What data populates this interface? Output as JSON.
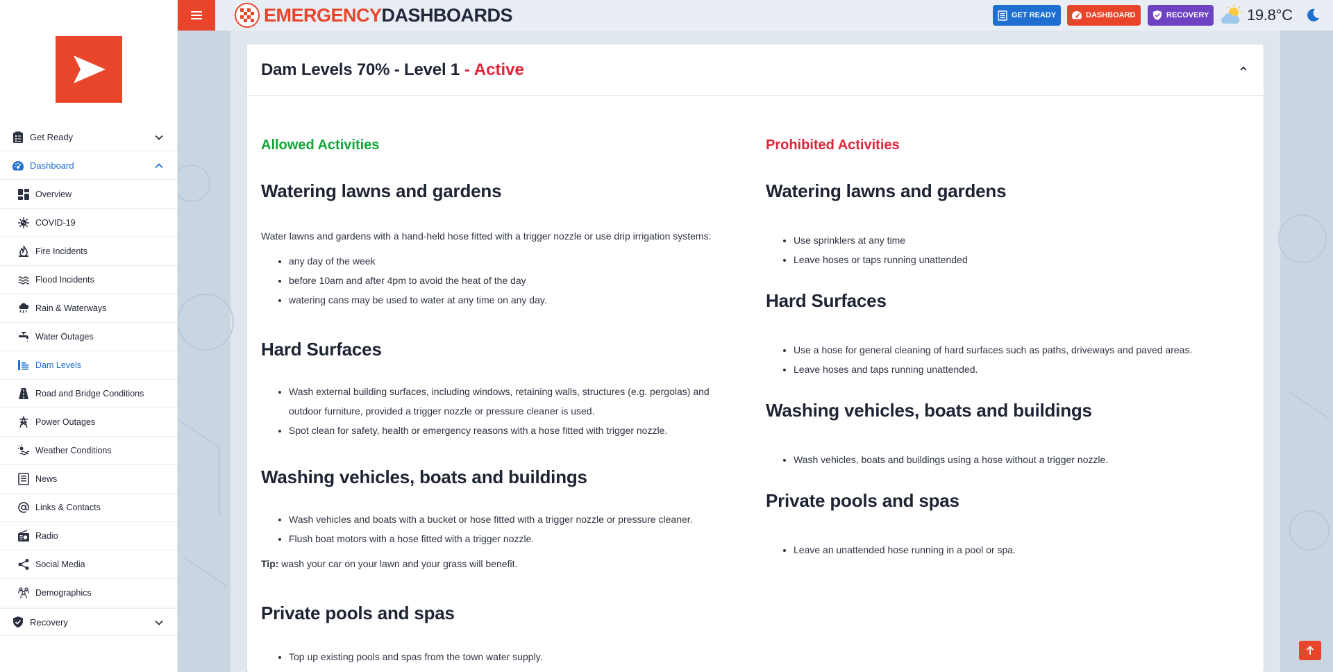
{
  "sidebar": {
    "groups": {
      "get_ready": "Get Ready",
      "dashboard": "Dashboard",
      "recovery": "Recovery"
    },
    "items": [
      {
        "label": "Overview",
        "icon": "grid-icon"
      },
      {
        "label": "COVID-19",
        "icon": "virus-icon"
      },
      {
        "label": "Fire Incidents",
        "icon": "fire-icon"
      },
      {
        "label": "Flood Incidents",
        "icon": "waves-icon"
      },
      {
        "label": "Rain & Waterways",
        "icon": "rain-cloud-icon"
      },
      {
        "label": "Water Outages",
        "icon": "tap-icon"
      },
      {
        "label": "Dam Levels",
        "icon": "dam-levels-icon",
        "active": true
      },
      {
        "label": "Road and Bridge Conditions",
        "icon": "road-icon"
      },
      {
        "label": "Power Outages",
        "icon": "power-pylon-icon"
      },
      {
        "label": "Weather Conditions",
        "icon": "weather-icon"
      },
      {
        "label": "News",
        "icon": "newspaper-icon"
      },
      {
        "label": "Links & Contacts",
        "icon": "at-sign-icon"
      },
      {
        "label": "Radio",
        "icon": "radio-icon"
      },
      {
        "label": "Social Media",
        "icon": "share-icon"
      },
      {
        "label": "Demographics",
        "icon": "people-icon"
      }
    ]
  },
  "topbar": {
    "brand_part1": "EMERGENCY",
    "brand_part2": "DASHBOARDS",
    "get_ready": "GET READY",
    "dashboard": "DASHBOARD",
    "recovery": "RECOVERY",
    "temperature": "19.8°C"
  },
  "colors": {
    "brand_red": "#e8452b",
    "blue": "#1f6fd1",
    "purple": "#6f42c1",
    "allowed_green": "#13a538",
    "prohibited_red": "#e0243b"
  },
  "card": {
    "title": "Dam Levels 70% - Level 1",
    "status": "- Active",
    "allowed": {
      "heading": "Allowed Activities",
      "sections": [
        {
          "title": "Watering lawns and gardens",
          "intro": "Water lawns and gardens with a hand-held hose fitted with a trigger nozzle or use drip irrigation systems:",
          "items": [
            "any day of the week",
            "before 10am and after 4pm to avoid the heat of the day",
            "watering cans may be used to water at any time on any day."
          ]
        },
        {
          "title": "Hard Surfaces",
          "items": [
            "Wash external building surfaces, including windows, retaining walls, structures (e.g. pergolas) and outdoor furniture, provided a trigger nozzle or pressure cleaner is used.",
            "Spot clean for safety, health or emergency reasons with a hose fitted with trigger nozzle."
          ]
        },
        {
          "title": "Washing vehicles, boats and buildings",
          "items": [
            "Wash vehicles and boats with a bucket or hose fitted with a trigger nozzle or pressure cleaner.",
            "Flush boat motors with a hose fitted with a trigger nozzle."
          ],
          "tip_label": "Tip:",
          "tip_text": " wash your car on your lawn and your grass will benefit."
        },
        {
          "title": "Private pools and spas",
          "items": [
            "Top up existing pools and spas from the town water supply."
          ]
        }
      ]
    },
    "prohibited": {
      "heading": "Prohibited Activities",
      "sections": [
        {
          "title": "Watering lawns and gardens",
          "items": [
            "Use sprinklers at any time",
            "Leave hoses or taps running unattended"
          ]
        },
        {
          "title": "Hard Surfaces",
          "items": [
            "Use a hose for general cleaning of hard surfaces such as paths, driveways and paved areas.",
            "Leave hoses and taps running unattended."
          ]
        },
        {
          "title": "Washing vehicles, boats and buildings",
          "items": [
            "Wash vehicles, boats and buildings using a hose without a trigger nozzle."
          ]
        },
        {
          "title": "Private pools and spas",
          "items": [
            "Leave an unattended hose running in a pool or spa."
          ]
        }
      ]
    }
  }
}
